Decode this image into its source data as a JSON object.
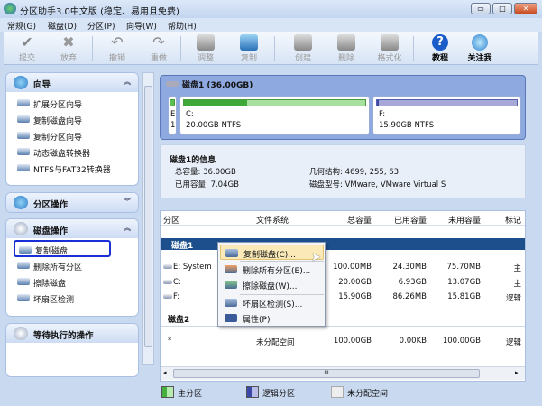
{
  "window": {
    "title": "分区助手3.0中文版 (稳定、易用且免费)",
    "minimize": "▭",
    "maximize": "□",
    "close": "✕"
  },
  "menu": [
    "常规(G)",
    "磁盘(D)",
    "分区(P)",
    "向导(W)",
    "帮助(H)"
  ],
  "toolbar": [
    "提交",
    "放弃",
    "撤销",
    "重做",
    "调整",
    "复制",
    "创建",
    "删除",
    "格式化",
    "教程",
    "关注我"
  ],
  "sidebar": {
    "wizard": {
      "title": "向导",
      "items": [
        "扩展分区向导",
        "复制磁盘向导",
        "复制分区向导",
        "动态磁盘转换器",
        "NTFS与FAT32转换器"
      ]
    },
    "partition_ops": {
      "title": "分区操作"
    },
    "disk_ops": {
      "title": "磁盘操作",
      "items": [
        "复制磁盘",
        "删除所有分区",
        "擦除磁盘",
        "坏扇区检测"
      ]
    },
    "pending": {
      "title": "等待执行的操作"
    }
  },
  "diskmap": {
    "title": "磁盘1 (36.00GB)",
    "parts": [
      {
        "l1": "E",
        "l2": "1"
      },
      {
        "l1": "C:",
        "l2": "20.00GB NTFS",
        "used_fraction": 0.35
      },
      {
        "l1": "F:",
        "l2": "15.90GB NTFS",
        "used_fraction": 0.01
      }
    ]
  },
  "info": {
    "title": "磁盘1的信息",
    "total": "总容量: 36.00GB",
    "used": "已用容量: 7.04GB",
    "geometry": "几何结构: 4699, 255, 63",
    "model": "磁盘型号: VMware, VMware Virtual S"
  },
  "table": {
    "headers": [
      "分区",
      "文件系统",
      "总容量",
      "已用容量",
      "未用容量",
      "标记"
    ],
    "disk1": "磁盘1",
    "disk2": "磁盘2",
    "rows": [
      [
        "E:  System",
        "",
        "100.00MB",
        "24.30MB",
        "75.70MB",
        "主"
      ],
      [
        "C:",
        "",
        "20.00GB",
        "6.93GB",
        "13.07GB",
        "主"
      ],
      [
        "F:",
        "",
        "15.90GB",
        "86.26MB",
        "15.81GB",
        "逻辑"
      ]
    ],
    "rows2": [
      [
        "*",
        "未分配空间",
        "100.00GB",
        "0.00KB",
        "100.00GB",
        "逻辑"
      ]
    ],
    "scroll_grip": "III"
  },
  "context_menu": [
    "复制磁盘(C)...",
    "删除所有分区(E)...",
    "擦除磁盘(W)...",
    "坏扇区检测(S)...",
    "属性(P)"
  ],
  "legend": [
    "主分区",
    "逻辑分区",
    "未分配空间"
  ],
  "colors": {
    "primary": "#46b03c",
    "logical": "#4a5fc0",
    "selected": "#1c4f8c",
    "highlight": "#1a2fd8"
  }
}
